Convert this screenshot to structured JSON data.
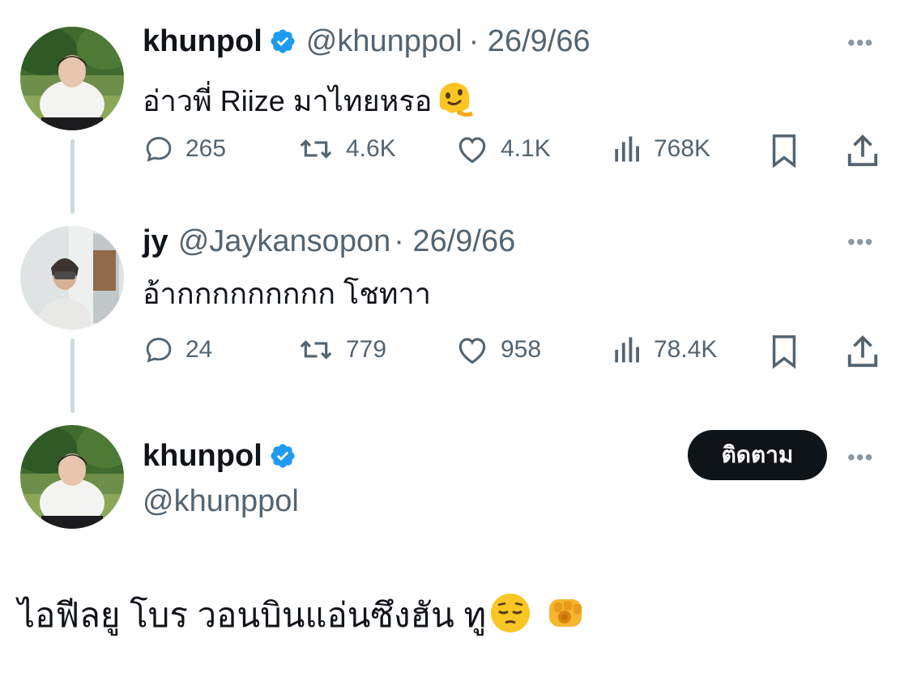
{
  "tweet1": {
    "name": "khunpol",
    "handle": "@khunppol",
    "date": "· 26/9/66",
    "text": "อ่าวพี่ Riize มาไทยหรอ",
    "emoji": "melting-face",
    "stats": {
      "replies": "265",
      "retweets": "4.6K",
      "likes": "4.1K",
      "views": "768K"
    }
  },
  "tweet2": {
    "name": "jy",
    "handle": "@Jaykansopon",
    "date": "· 26/9/66",
    "text": "อ้ากกกกกกกกก โชทาา",
    "stats": {
      "replies": "24",
      "retweets": "779",
      "likes": "958",
      "views": "78.4K"
    }
  },
  "tweet3": {
    "name": "khunpol",
    "handle": "@khunppol",
    "follow_label": "ติดตาม",
    "text": "ไอฟีลยู โบร วอนบินแอ่นซึงฮัน ทู",
    "emojis": [
      "pensive-face",
      "backhand-index-pointing-at-viewer"
    ]
  },
  "colors": {
    "verified": "#1d9bf0",
    "text": "#0f1419",
    "secondary": "#536471",
    "thread_line": "#cfd9de",
    "follow_button": "#0f1419"
  }
}
